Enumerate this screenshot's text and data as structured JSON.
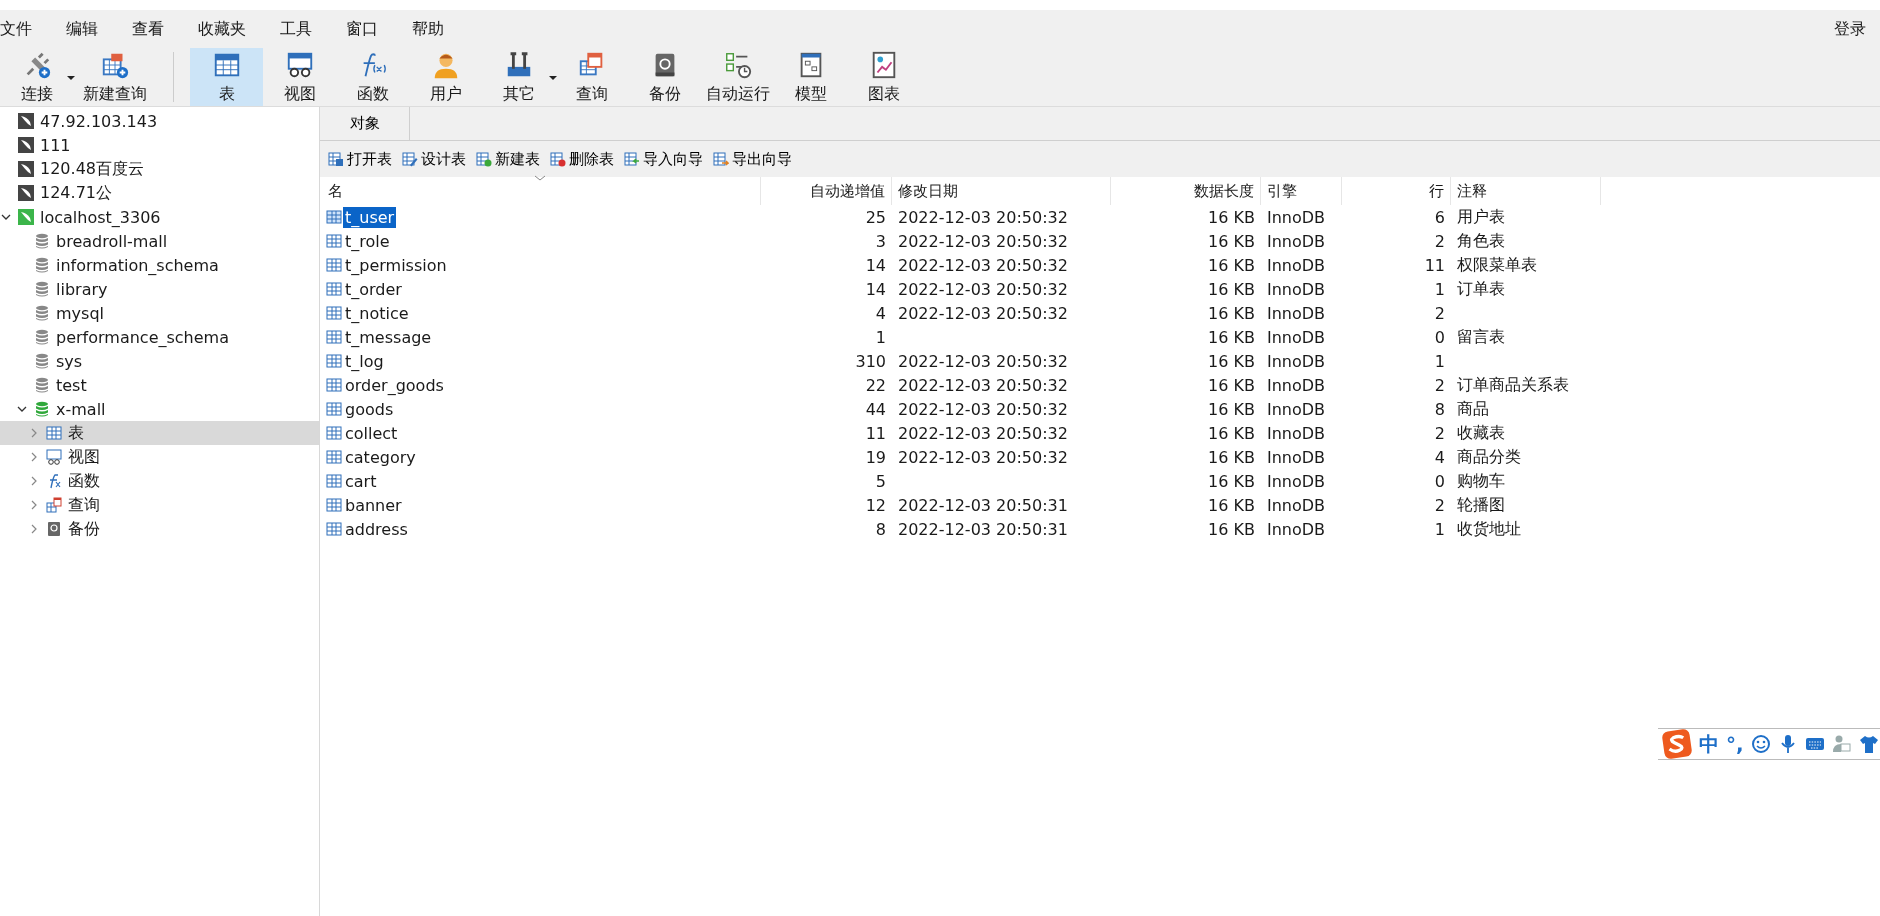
{
  "menu": [
    "文件",
    "编辑",
    "查看",
    "收藏夹",
    "工具",
    "窗口",
    "帮助"
  ],
  "login": "登录",
  "toolbar": [
    {
      "label": "连接",
      "selected": false,
      "dropdown": true
    },
    {
      "label": "新建查询",
      "selected": false,
      "dropdown": false
    },
    {
      "label": "表",
      "selected": true,
      "dropdown": false
    },
    {
      "label": "视图",
      "selected": false,
      "dropdown": false
    },
    {
      "label": "函数",
      "selected": false,
      "dropdown": false
    },
    {
      "label": "用户",
      "selected": false,
      "dropdown": false
    },
    {
      "label": "其它",
      "selected": false,
      "dropdown": true
    },
    {
      "label": "查询",
      "selected": false,
      "dropdown": false
    },
    {
      "label": "备份",
      "selected": false,
      "dropdown": false
    },
    {
      "label": "自动运行",
      "selected": false,
      "dropdown": false
    },
    {
      "label": "模型",
      "selected": false,
      "dropdown": false
    },
    {
      "label": "图表",
      "selected": false,
      "dropdown": false
    }
  ],
  "sidebar": {
    "items": [
      {
        "label": "47.92.103.143",
        "kind": "connection",
        "open": false,
        "expanded": false
      },
      {
        "label": "111",
        "kind": "connection",
        "open": false,
        "expanded": false
      },
      {
        "label": "120.48百度云",
        "kind": "connection",
        "open": false,
        "expanded": false
      },
      {
        "label": "124.71公",
        "kind": "connection",
        "open": false,
        "expanded": false
      },
      {
        "label": "localhost_3306",
        "kind": "connection",
        "open": true,
        "expanded": true,
        "children": [
          {
            "label": "breadroll-mall",
            "kind": "database",
            "open": false,
            "expanded": false
          },
          {
            "label": "information_schema",
            "kind": "database",
            "open": false,
            "expanded": false
          },
          {
            "label": "library",
            "kind": "database",
            "open": false,
            "expanded": false
          },
          {
            "label": "mysql",
            "kind": "database",
            "open": false,
            "expanded": false
          },
          {
            "label": "performance_schema",
            "kind": "database",
            "open": false,
            "expanded": false
          },
          {
            "label": "sys",
            "kind": "database",
            "open": false,
            "expanded": false
          },
          {
            "label": "test",
            "kind": "database",
            "open": false,
            "expanded": false
          },
          {
            "label": "x-mall",
            "kind": "database",
            "open": true,
            "expanded": true,
            "children": [
              {
                "label": "表",
                "kind": "table",
                "expanded": false,
                "selected": true
              },
              {
                "label": "视图",
                "kind": "view",
                "expanded": false,
                "selected": false
              },
              {
                "label": "函数",
                "kind": "function",
                "expanded": false,
                "selected": false
              },
              {
                "label": "查询",
                "kind": "query",
                "expanded": false,
                "selected": false
              },
              {
                "label": "备份",
                "kind": "backup",
                "expanded": false,
                "selected": false
              }
            ]
          }
        ]
      }
    ]
  },
  "tabs": [
    {
      "label": "对象",
      "selected": true
    }
  ],
  "actions": [
    "打开表",
    "设计表",
    "新建表",
    "删除表",
    "导入向导",
    "导出向导"
  ],
  "table": {
    "columns": [
      "名",
      "自动递增值",
      "修改日期",
      "数据长度",
      "引擎",
      "行",
      "注释"
    ],
    "rows": [
      {
        "name": "t_user",
        "auto_increment": "25",
        "modified": "2022-12-03 20:50:32",
        "data_length": "16 KB",
        "engine": "InnoDB",
        "rows": "6",
        "comment": "用户表",
        "selected": true
      },
      {
        "name": "t_role",
        "auto_increment": "3",
        "modified": "2022-12-03 20:50:32",
        "data_length": "16 KB",
        "engine": "InnoDB",
        "rows": "2",
        "comment": "角色表",
        "selected": false
      },
      {
        "name": "t_permission",
        "auto_increment": "14",
        "modified": "2022-12-03 20:50:32",
        "data_length": "16 KB",
        "engine": "InnoDB",
        "rows": "11",
        "comment": "权限菜单表",
        "selected": false
      },
      {
        "name": "t_order",
        "auto_increment": "14",
        "modified": "2022-12-03 20:50:32",
        "data_length": "16 KB",
        "engine": "InnoDB",
        "rows": "1",
        "comment": "订单表",
        "selected": false
      },
      {
        "name": "t_notice",
        "auto_increment": "4",
        "modified": "2022-12-03 20:50:32",
        "data_length": "16 KB",
        "engine": "InnoDB",
        "rows": "2",
        "selected": false
      },
      {
        "name": "t_message",
        "auto_increment": "1",
        "data_length": "16 KB",
        "engine": "InnoDB",
        "rows": "0",
        "comment": "留言表",
        "selected": false
      },
      {
        "name": "t_log",
        "auto_increment": "310",
        "modified": "2022-12-03 20:50:32",
        "data_length": "16 KB",
        "engine": "InnoDB",
        "rows": "1",
        "selected": false
      },
      {
        "name": "order_goods",
        "auto_increment": "22",
        "modified": "2022-12-03 20:50:32",
        "data_length": "16 KB",
        "engine": "InnoDB",
        "rows": "2",
        "comment": "订单商品关系表",
        "selected": false
      },
      {
        "name": "goods",
        "auto_increment": "44",
        "modified": "2022-12-03 20:50:32",
        "data_length": "16 KB",
        "engine": "InnoDB",
        "rows": "8",
        "comment": "商品",
        "selected": false
      },
      {
        "name": "collect",
        "auto_increment": "11",
        "modified": "2022-12-03 20:50:32",
        "data_length": "16 KB",
        "engine": "InnoDB",
        "rows": "2",
        "comment": "收藏表",
        "selected": false
      },
      {
        "name": "category",
        "auto_increment": "19",
        "modified": "2022-12-03 20:50:32",
        "data_length": "16 KB",
        "engine": "InnoDB",
        "rows": "4",
        "comment": "商品分类",
        "selected": false
      },
      {
        "name": "cart",
        "auto_increment": "5",
        "data_length": "16 KB",
        "engine": "InnoDB",
        "rows": "0",
        "comment": "购物车",
        "selected": false
      },
      {
        "name": "banner",
        "auto_increment": "12",
        "modified": "2022-12-03 20:50:31",
        "data_length": "16 KB",
        "engine": "InnoDB",
        "rows": "2",
        "comment": "轮播图",
        "selected": false
      },
      {
        "name": "address",
        "auto_increment": "8",
        "modified": "2022-12-03 20:50:31",
        "data_length": "16 KB",
        "engine": "InnoDB",
        "rows": "1",
        "comment": "收货地址",
        "selected": false
      }
    ]
  },
  "ime_bar": {
    "mode": "中",
    "punctuation": "°,"
  }
}
